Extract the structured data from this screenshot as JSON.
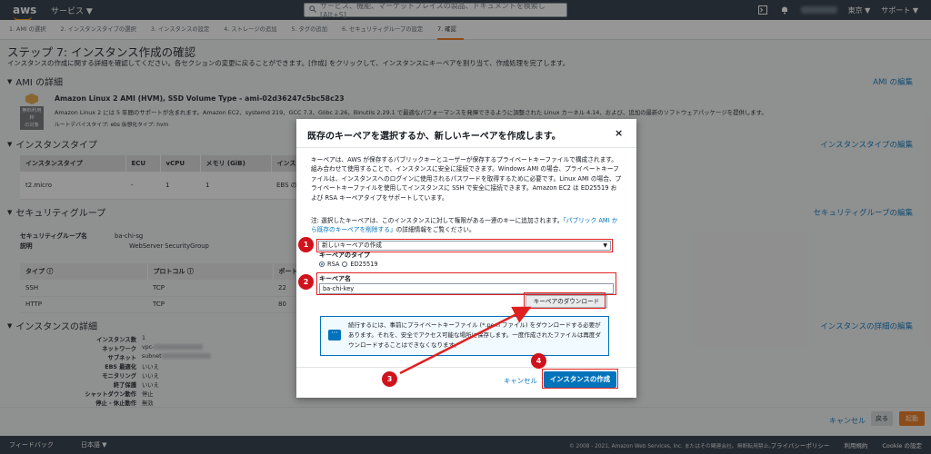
{
  "topnav": {
    "logo": "aws",
    "services": "サービス ▼",
    "search_placeholder": "サービス、機能、マーケットプレイスの製品、ドキュメントを検索し [Alt+S]",
    "region": "東京 ▼",
    "support": "サポート ▼"
  },
  "steps": [
    "1. AMI の選択",
    "2. インスタンスタイプの選択",
    "3. インスタンスの設定",
    "4. ストレージの追加",
    "5. タグの追加",
    "6. セキュリティグループの設定",
    "7. 確認"
  ],
  "page": {
    "title": "ステップ 7: インスタンス作成の確認",
    "description": "インスタンスの作成に関する詳細を確認してください。各セクションの変更に戻ることができます。[作成] をクリックして、インスタンスにキーペアを割り当て、作成処理を完了します。"
  },
  "ami": {
    "heading": "AMI の詳細",
    "edit": "AMI の編集",
    "badge_line1": "無料利用枠",
    "badge_line2": "の対象",
    "name": "Amazon Linux 2 AMI (HVM), SSD Volume Type - ami-02d36247c5bc58c23",
    "desc": "Amazon Linux 2 には 5 年間のサポートが含まれます。Amazon EC2、systemd 219、GCC 7.3、Glibc 2.26、Binutils 2.29.1 で最適なパフォーマンスを発揮できるように調整された Linux カーネル 4.14、および、追加の最新のソフトウェアパッケージを提供します。",
    "meta": "ルートデバイスタイプ: ebs    仮想化タイプ: hvm"
  },
  "instance_type": {
    "heading": "インスタンスタイプ",
    "edit": "インスタンスタイプの編集",
    "columns": [
      "インスタンスタイプ",
      "ECU",
      "vCPU",
      "メモリ (GiB)",
      "インスタ"
    ],
    "row": [
      "t2.micro",
      "-",
      "1",
      "1",
      "EBS のみ"
    ]
  },
  "security": {
    "heading": "セキュリティグループ",
    "edit": "セキュリティグループの編集",
    "name_label": "セキュリティグループ名",
    "name_value": "ba-chi-sg",
    "desc_label": "説明",
    "desc_value": "WebServer SecurityGroup",
    "columns": [
      "タイプ ⓘ",
      "プロトコル ⓘ",
      "ポート"
    ],
    "rows": [
      [
        "SSH",
        "TCP",
        "22"
      ],
      [
        "HTTP",
        "TCP",
        "80"
      ]
    ]
  },
  "details": {
    "heading": "インスタンスの詳細",
    "edit": "インスタンスの詳細の編集",
    "rows": [
      {
        "k": "インスタンス数",
        "v": "1"
      },
      {
        "k": "ネットワーク",
        "v": "vpc-"
      },
      {
        "k": "サブネット",
        "v": "subnet"
      },
      {
        "k": "EBS 最適化",
        "v": "いいえ"
      },
      {
        "k": "モニタリング",
        "v": "いいえ"
      },
      {
        "k": "終了保護",
        "v": "いいえ"
      },
      {
        "k": "シャットダウン動作",
        "v": "停止"
      },
      {
        "k": "停止 - 休止動作",
        "v": "無効"
      }
    ]
  },
  "actions": {
    "cancel": "キャンセル",
    "back": "戻る",
    "launch": "起動"
  },
  "footer": {
    "feedback": "フィードバック",
    "language": "日本語 ▼",
    "copyright": "© 2008 - 2021, Amazon Web Services, Inc. またはその関連会社。無断転用禁止。",
    "privacy": "プライバシーポリシー",
    "terms": "利用規約",
    "cookie": "Cookie の設定"
  },
  "modal": {
    "title": "既存のキーペアを選択するか、新しいキーペアを作成します。",
    "close": "×",
    "body": "キーペアは、AWS が保存するパブリックキーとユーザーが保存するプライベートキーファイルで構成されます。組み合わせて使用することで、インスタンスに安全に接続できます。Windows AMI の場合、プライベートキーファイルは、インスタンスへのログインに使用されるパスワードを取得するために必要です。Linux AMI の場合、プライベートキーファイルを使用してインスタンスに SSH で安全に接続できます。Amazon EC2 は ED25519 および RSA キーペアタイプをサポートしています。",
    "note": "注: 選択したキーペアは、このインスタンスに対して権限がある一連のキーに追加されます。",
    "note_link": "パブリック AMI から既存のキーペアを削除する",
    "note_tail": "の詳細情報をご覧ください。",
    "select_value": "新しいキーペアの作成",
    "type_label": "キーペアのタイプ",
    "type_rsa": "RSA",
    "type_ed": "ED25519",
    "name_label": "キーペア名",
    "name_value": "ba-chi-key",
    "download": "キーペアのダウンロード",
    "info": "続行するには、事前にプライベートキーファイル (*.pem ファイル) をダウンロードする必要があります。それを、安全でアクセス可能な場所に保存します。一度作成されたファイルは再度ダウンロードすることはできなくなります。",
    "cancel": "キャンセル",
    "launch": "インスタンスの作成"
  },
  "annotations": [
    "1",
    "2",
    "3",
    "4"
  ],
  "colors": {
    "nav_bg": "#232f3e",
    "accent": "#ec7211",
    "primary": "#0073bb",
    "annotation": "#d0121c"
  }
}
